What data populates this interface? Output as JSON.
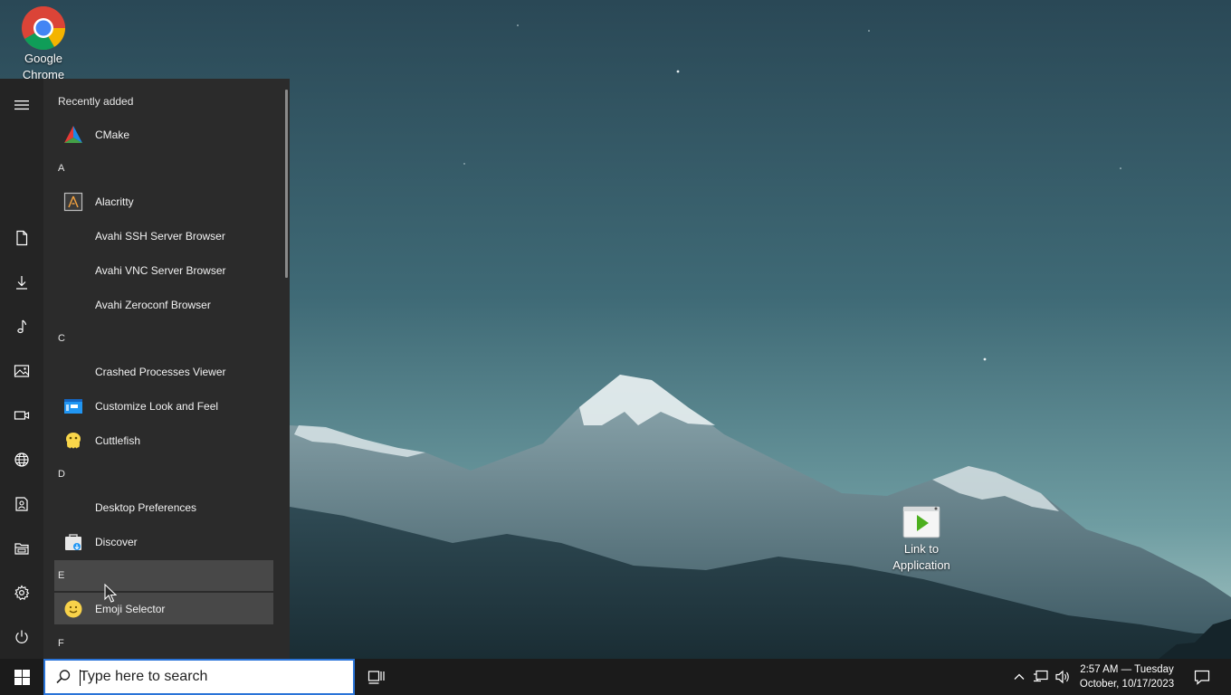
{
  "desktop": {
    "icons": [
      {
        "label": "Google Chrome",
        "icon": "chrome-icon"
      },
      {
        "label": "Link to Application",
        "icon": "application-link-icon"
      }
    ]
  },
  "start_menu": {
    "rail": [
      {
        "icon": "hamburger-menu-icon",
        "label": "Expand"
      },
      {
        "icon": "document-icon",
        "label": "Documents"
      },
      {
        "icon": "download-icon",
        "label": "Downloads"
      },
      {
        "icon": "music-note-icon",
        "label": "Music"
      },
      {
        "icon": "image-icon",
        "label": "Pictures"
      },
      {
        "icon": "video-icon",
        "label": "Videos"
      },
      {
        "icon": "network-globe-icon",
        "label": "Network"
      },
      {
        "icon": "user-folder-icon",
        "label": "Personal folder"
      },
      {
        "icon": "file-explorer-icon",
        "label": "File Explorer"
      },
      {
        "icon": "settings-gear-icon",
        "label": "Settings"
      },
      {
        "icon": "power-icon",
        "label": "Power"
      }
    ],
    "header": "Recently added",
    "items": [
      {
        "kind": "app",
        "label": "CMake",
        "icon": "cmake-icon"
      },
      {
        "kind": "section",
        "label": "A"
      },
      {
        "kind": "app",
        "label": "Alacritty",
        "icon": "alacritty-icon"
      },
      {
        "kind": "app",
        "label": "Avahi SSH Server Browser",
        "icon": ""
      },
      {
        "kind": "app",
        "label": "Avahi VNC Server Browser",
        "icon": ""
      },
      {
        "kind": "app",
        "label": "Avahi Zeroconf Browser",
        "icon": ""
      },
      {
        "kind": "section",
        "label": "C"
      },
      {
        "kind": "app",
        "label": "Crashed Processes Viewer",
        "icon": ""
      },
      {
        "kind": "app",
        "label": "Customize Look and Feel",
        "icon": "customize-look-icon"
      },
      {
        "kind": "app",
        "label": "Cuttlefish",
        "icon": "cuttlefish-icon"
      },
      {
        "kind": "section",
        "label": "D"
      },
      {
        "kind": "app",
        "label": "Desktop Preferences",
        "icon": ""
      },
      {
        "kind": "app",
        "label": "Discover",
        "icon": "discover-icon"
      },
      {
        "kind": "section",
        "label": "E"
      },
      {
        "kind": "app",
        "label": "Emoji Selector",
        "icon": "emoji-icon"
      },
      {
        "kind": "section",
        "label": "F"
      }
    ]
  },
  "taskbar": {
    "start_icon": "windows-start-icon",
    "search": {
      "placeholder": "Type here to search",
      "value": ""
    },
    "task_view_icon": "task-view-icon",
    "tray_icons": [
      "chevron-up-icon",
      "network-icon",
      "volume-icon"
    ],
    "clock": {
      "time": "2:57 AM — Tuesday",
      "date": "October, 10/17/2023"
    },
    "notifications_icon": "notification-icon"
  },
  "colors": {
    "start_menu_bg": "#2b2b2b",
    "rail_bg": "#242424",
    "taskbar_bg": "#1b1b1b",
    "search_border": "#2a74d8",
    "hover_row": "#484848"
  }
}
